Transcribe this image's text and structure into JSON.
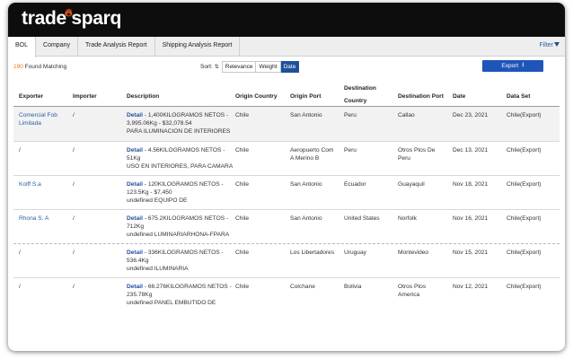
{
  "brand": {
    "name": "trade sparq",
    "part1": "trade",
    "part2": "sparq"
  },
  "tabs": [
    "BOL",
    "Company",
    "Trade Analysis Report",
    "Shipping Analysis Report"
  ],
  "filter_label": "Filter",
  "results": {
    "count": "190",
    "suffix": " Found Matching"
  },
  "sort": {
    "label": "Sort:",
    "options": [
      "Relevance",
      "Weight",
      "Date"
    ],
    "selected": "Date"
  },
  "export_label": "Export",
  "table": {
    "headers": {
      "exporter": "Exporter",
      "importer": "Importer",
      "description": "Description",
      "origin_country": "Origin Country",
      "origin_port": "Origin Port",
      "dest_country_1": "Destination",
      "dest_country_2": "Country",
      "dest_port": "Destination Port",
      "date": "Date",
      "dataset": "Data Set"
    },
    "rows": [
      {
        "exporter_1": "Comercial Fob",
        "exporter_2": "Limitada",
        "importer": "/",
        "detail": "Detail",
        "desc_1": " - 1,400KILOGRAMOS NETOS -",
        "desc_2": "3,995.06Kg - $32,078.54",
        "desc_3": "PARA ILUMINACION DE INTERIORES",
        "origin_country": "Chile",
        "origin_port_1": "San Antonio",
        "origin_port_2": "",
        "dest_country": "Peru",
        "dest_port_1": "Callao",
        "dest_port_2": "",
        "date": "Dec 23, 2021",
        "dataset": "Chile(Export)"
      },
      {
        "exporter_1": "/",
        "exporter_2": "",
        "importer": "/",
        "detail": "Detail",
        "desc_1": " - 4.56KILOGRAMOS NETOS -",
        "desc_2": "51Kg",
        "desc_3": "USO EN INTERIORES, PARA CAMARA",
        "origin_country": "Chile",
        "origin_port_1": "Aeropuerto Com",
        "origin_port_2": "A Merino B",
        "dest_country": "Peru",
        "dest_port_1": "Otros Ptos De",
        "dest_port_2": "Peru",
        "date": "Dec 13, 2021",
        "dataset": "Chile(Export)"
      },
      {
        "exporter_1": "Kolff S.a",
        "exporter_2": "",
        "importer": "/",
        "detail": "Detail",
        "desc_1": " - 120KILOGRAMOS NETOS -",
        "desc_2": "123.5Kg - $7,450",
        "desc_3": "undefined EQUIPO DE",
        "origin_country": "Chile",
        "origin_port_1": "San Antonio",
        "origin_port_2": "",
        "dest_country": "Ecuador",
        "dest_port_1": "Guayaquil",
        "dest_port_2": "",
        "date": "Nov 18, 2021",
        "dataset": "Chile(Export)"
      },
      {
        "exporter_1": "Rhona S. A",
        "exporter_2": "",
        "importer": "/",
        "detail": "Detail",
        "desc_1": " - 675.2KILOGRAMOS NETOS -",
        "desc_2": "712Kg",
        "desc_3": "undefined LUMINARIARHONA-FPARA",
        "origin_country": "Chile",
        "origin_port_1": "San Antonio",
        "origin_port_2": "",
        "dest_country": "United States",
        "dest_port_1": "Norfolk",
        "dest_port_2": "",
        "date": "Nov 16, 2021",
        "dataset": "Chile(Export)"
      },
      {
        "exporter_1": "/",
        "exporter_2": "",
        "importer": "/",
        "detail": "Detail",
        "desc_1": " - 336KILOGRAMOS NETOS -",
        "desc_2": "536.4Kg",
        "desc_3": "undefined ILUMINARIA",
        "origin_country": "Chile",
        "origin_port_1": "Los Libertadores",
        "origin_port_2": "",
        "dest_country": "Uruguay",
        "dest_port_1": "Montevideo",
        "dest_port_2": "",
        "date": "Nov 15, 2021",
        "dataset": "Chile(Export)"
      },
      {
        "exporter_1": "/",
        "exporter_2": "",
        "importer": "/",
        "detail": "Detail",
        "desc_1": " - 66.276KILOGRAMOS NETOS -",
        "desc_2": "235.78Kg",
        "desc_3": "undefined PANEL EMBUTIDO DE",
        "origin_country": "Chile",
        "origin_port_1": "Colchane",
        "origin_port_2": "",
        "dest_country": "Bolivia",
        "dest_port_1": "Otros Ptos",
        "dest_port_2": "America",
        "date": "Nov 12, 2021",
        "dataset": "Chile(Export)"
      }
    ]
  },
  "colors": {
    "accent": "#1e55b8",
    "count": "#e07a1f",
    "link": "#2a5da8",
    "flame": "#e8541d"
  }
}
